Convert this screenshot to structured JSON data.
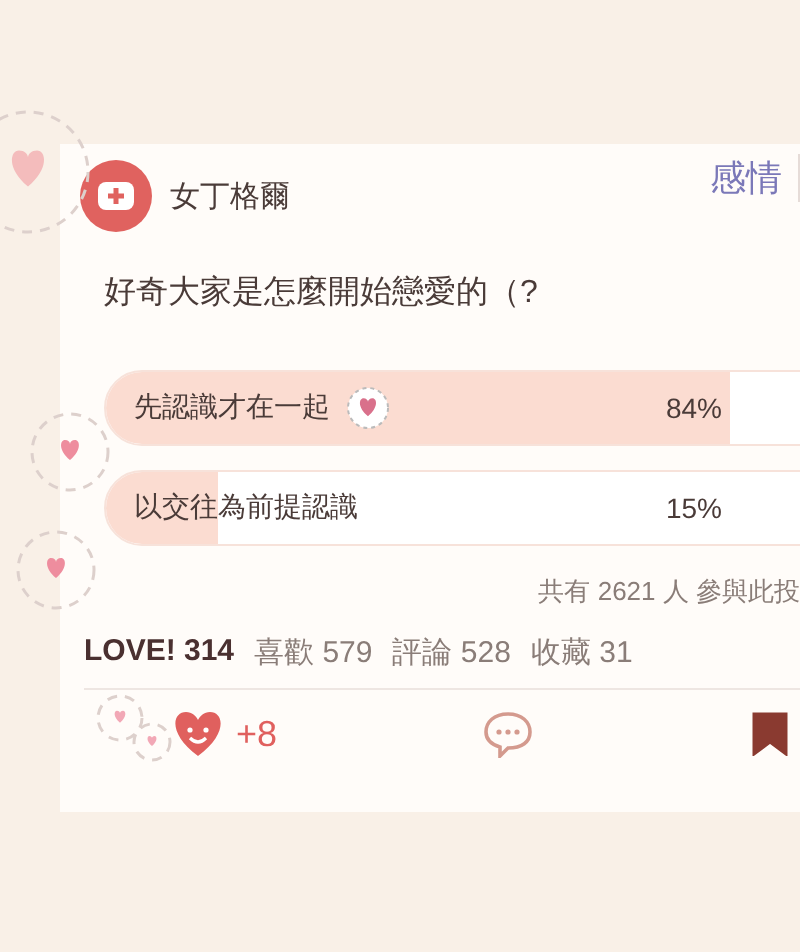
{
  "post": {
    "author": "女丁格爾",
    "board": "感情",
    "question": "好奇大家是怎麼開始戀愛的（?"
  },
  "poll": {
    "options": [
      {
        "label": "先認識才在一起",
        "percent": "84%",
        "level": 0.84,
        "selected": true
      },
      {
        "label": "以交往為前提認識",
        "percent": "15%",
        "level": 0.15,
        "selected": false
      }
    ],
    "summary": "共有 2621 人 參與此投"
  },
  "stats": {
    "love": "LOVE! 314",
    "items": [
      "喜歡 579",
      "評論 528",
      "收藏 31"
    ]
  },
  "actions": {
    "reaction_count": "+8",
    "bookmarked": true
  }
}
